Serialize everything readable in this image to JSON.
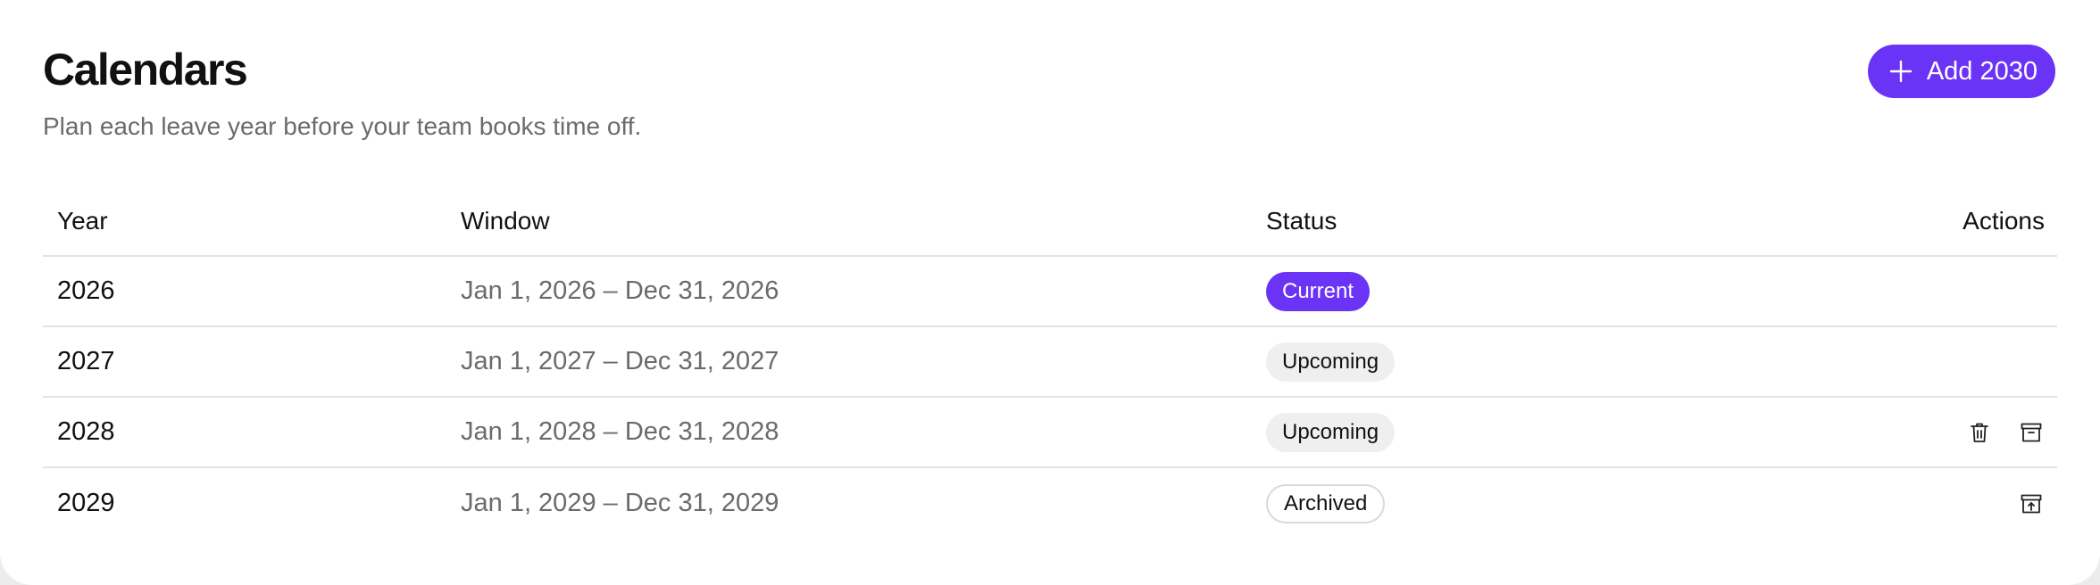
{
  "header": {
    "title": "Calendars",
    "subtitle": "Plan each leave year before your team books time off.",
    "add_button_label": "Add 2030",
    "add_button_icon": "plus-icon"
  },
  "table": {
    "columns": [
      "Year",
      "Window",
      "Status",
      "Actions"
    ],
    "rows": [
      {
        "year": "2026",
        "window": "Jan 1, 2026 – Dec 31, 2026",
        "status": "Current",
        "actions": []
      },
      {
        "year": "2027",
        "window": "Jan 1, 2027 – Dec 31, 2027",
        "status": "Upcoming",
        "actions": []
      },
      {
        "year": "2028",
        "window": "Jan 1, 2028 – Dec 31, 2028",
        "status": "Upcoming",
        "actions": [
          "trash-icon",
          "archive-icon"
        ]
      },
      {
        "year": "2029",
        "window": "Jan 1, 2029 – Dec 31, 2029",
        "status": "Archived",
        "actions": [
          "unarchive-icon"
        ]
      }
    ]
  },
  "colors": {
    "accent": "#6a33f5",
    "badge_upcoming_bg": "#efefef",
    "muted_text": "#6b6b6b",
    "divider": "#e3e3e3"
  }
}
